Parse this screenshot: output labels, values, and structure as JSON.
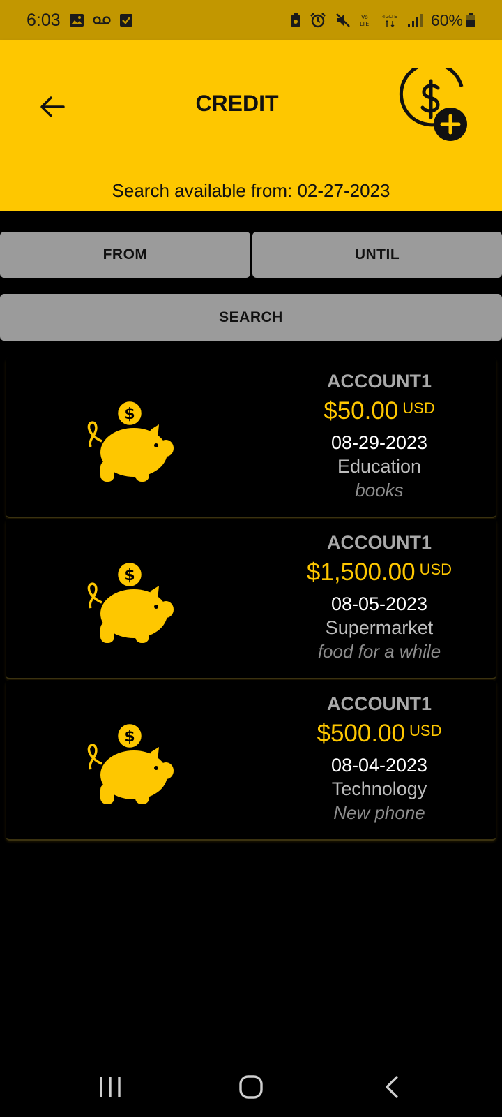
{
  "status_bar": {
    "time": "6:03",
    "battery": "60%",
    "icons": [
      "image-icon",
      "voicemail-icon",
      "checkbox-icon",
      "battery-saver-icon",
      "alarm-icon",
      "mute-icon",
      "volte-icon",
      "4g-lte-icon",
      "signal-icon",
      "battery-icon"
    ]
  },
  "app_bar": {
    "title": "CREDIT",
    "back_icon": "arrow-left-icon",
    "action_icon": "add-money-icon"
  },
  "search_note": "Search available from: 02-27-2023",
  "filters": {
    "from_label": "FROM",
    "until_label": "UNTIL",
    "search_label": "SEARCH"
  },
  "transactions": [
    {
      "account": "ACCOUNT1",
      "amount": "$50.00",
      "currency": "USD",
      "date": "08-29-2023",
      "category": "Education",
      "note": "books",
      "icon": "piggy-bank-icon"
    },
    {
      "account": "ACCOUNT1",
      "amount": "$1,500.00",
      "currency": "USD",
      "date": "08-05-2023",
      "category": "Supermarket",
      "note": "food for a while",
      "icon": "piggy-bank-icon"
    },
    {
      "account": "ACCOUNT1",
      "amount": "$500.00",
      "currency": "USD",
      "date": "08-04-2023",
      "category": "Technology",
      "note": "New phone",
      "icon": "piggy-bank-icon"
    }
  ],
  "nav_bar": {
    "icons": [
      "recent-apps-icon",
      "home-icon",
      "back-icon"
    ]
  },
  "colors": {
    "accent": "#fec700",
    "status_bar": "#c29700",
    "button_gray": "#9b9b9b",
    "background": "#000000"
  }
}
